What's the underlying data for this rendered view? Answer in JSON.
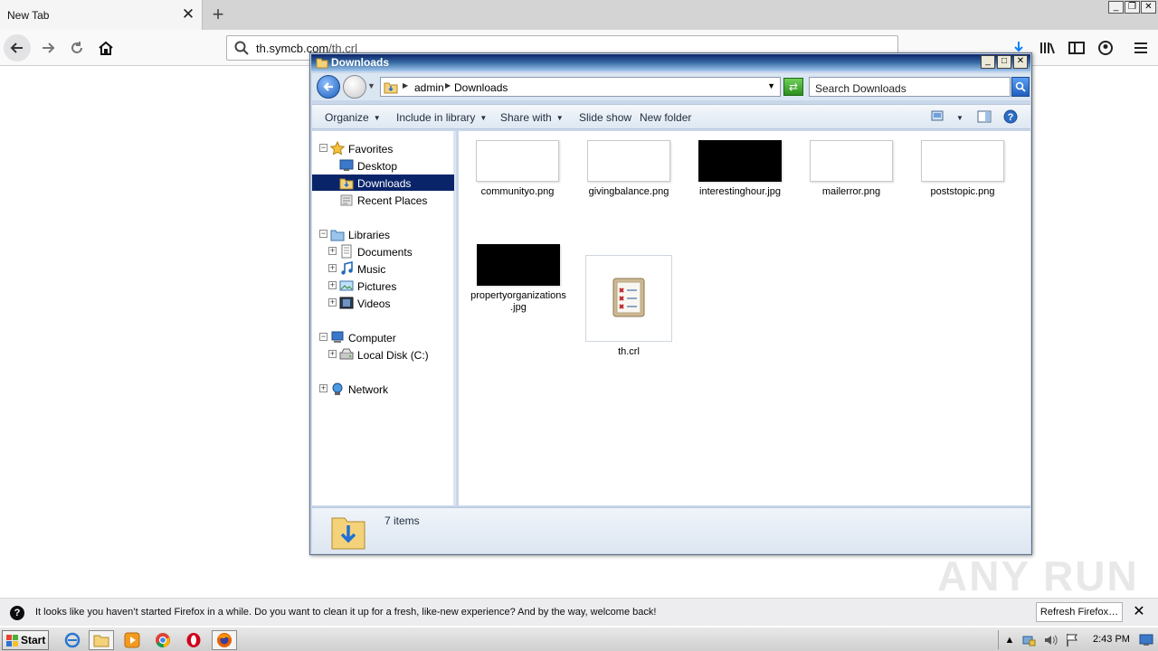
{
  "browser": {
    "tab_title": "New Tab",
    "url_prefix": "th.symcb.com",
    "url_suffix": "/th.crl"
  },
  "explorer": {
    "title": "Downloads",
    "breadcrumb": [
      "admin",
      "Downloads"
    ],
    "search_placeholder": "Search Downloads",
    "toolbar": {
      "organize": "Organize",
      "include_in_library": "Include in library",
      "share_with": "Share with",
      "slide_show": "Slide show",
      "new_folder": "New folder"
    },
    "nav": {
      "favorites": "Favorites",
      "desktop": "Desktop",
      "downloads": "Downloads",
      "recent_places": "Recent Places",
      "libraries": "Libraries",
      "documents": "Documents",
      "music": "Music",
      "pictures": "Pictures",
      "videos": "Videos",
      "computer": "Computer",
      "local_disk": "Local Disk (C:)",
      "network": "Network"
    },
    "files": [
      {
        "name": "communityo.png",
        "thumb": "light"
      },
      {
        "name": "givingbalance.png",
        "thumb": "light"
      },
      {
        "name": "interestinghour.jpg",
        "thumb": "dark"
      },
      {
        "name": "mailerror.png",
        "thumb": "light"
      },
      {
        "name": "poststopic.png",
        "thumb": "light"
      },
      {
        "name": "propertyorganizations.jpg",
        "thumb": "dark"
      },
      {
        "name": "th.crl",
        "thumb": "certificate-icon"
      }
    ],
    "status": "7 items"
  },
  "notification": {
    "text": "It looks like you haven’t started Firefox in a while. Do you want to clean it up for a fresh, like-new experience? And by the way, welcome back!",
    "button": "Refresh Firefox…"
  },
  "watermark": "ANY RUN",
  "taskbar": {
    "start": "Start",
    "clock": "2:43 PM"
  },
  "colors": {
    "explorer_title_start": "#0a246a",
    "selection": "#0a246a",
    "notif_bg": "#ededf0"
  }
}
